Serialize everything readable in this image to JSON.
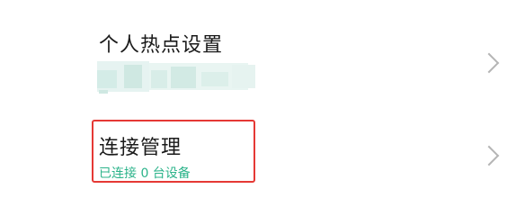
{
  "settings": {
    "hotspot": {
      "title": "个人热点设置",
      "value_obscured": true
    },
    "connection": {
      "title": "连接管理",
      "subtitle": "已连接 0 台设备"
    }
  },
  "colors": {
    "subtitle_green": "#2bb38a",
    "highlight_red": "#e53935",
    "chevron_gray": "#b5b5b5"
  },
  "icons": {
    "row_chevron": "chevron-right-icon"
  }
}
